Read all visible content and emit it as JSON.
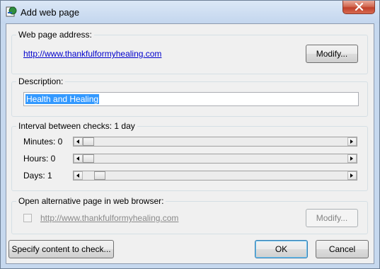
{
  "window": {
    "title": "Add web page",
    "close_label": "close"
  },
  "web_address": {
    "legend": "Web page address:",
    "url": "http://www.thankfulformyhealing.com",
    "modify_label": "Modify..."
  },
  "description": {
    "legend": "Description:",
    "value": "Health and Healing"
  },
  "interval": {
    "legend": "Interval between checks: 1 day",
    "minutes_label": "Minutes: 0",
    "hours_label": "Hours: 0",
    "days_label": "Days: 1",
    "minutes_value": 0,
    "hours_value": 0,
    "days_value": 1
  },
  "alternative": {
    "legend": "Open alternative page in web browser:",
    "checked": false,
    "url": "http://www.thankfulformyhealing.com",
    "modify_label": "Modify..."
  },
  "footer": {
    "specify_label": "Specify content to check...",
    "ok_label": "OK",
    "cancel_label": "Cancel"
  },
  "icons": [
    "app-icon",
    "close-icon",
    "arrow-left-icon",
    "arrow-right-icon"
  ],
  "colors": {
    "link": "#0000cc",
    "selection": "#3399ff",
    "close_button": "#c0402a"
  }
}
